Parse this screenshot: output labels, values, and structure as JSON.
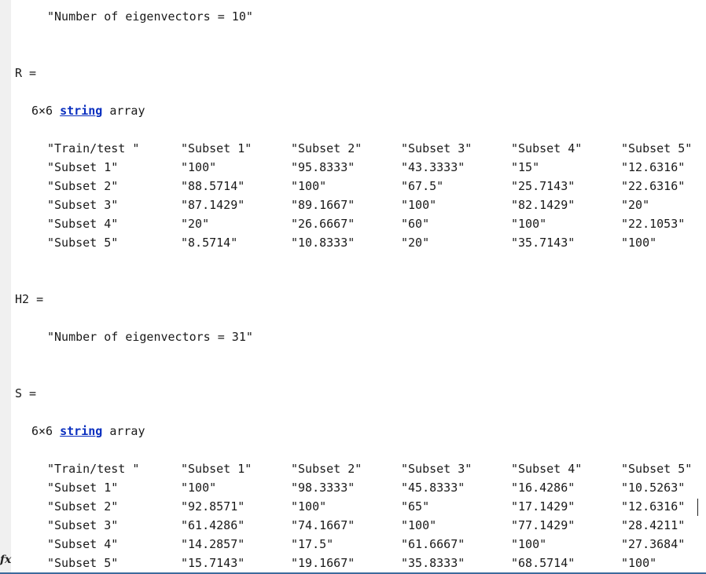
{
  "h1_value": "\"Number of eigenvectors = 10\"",
  "r_block": {
    "label": "R =",
    "size_text": "6×6",
    "class_link": "string",
    "class_suffix": "array",
    "rows": [
      [
        "\"Train/test \"",
        "\"Subset 1\"",
        "\"Subset 2\"",
        "\"Subset 3\"",
        "\"Subset 4\"",
        "\"Subset 5\""
      ],
      [
        "\"Subset 1\"",
        "\"100\"",
        "\"95.8333\"",
        "\"43.3333\"",
        "\"15\"",
        "\"12.6316\""
      ],
      [
        "\"Subset 2\"",
        "\"88.5714\"",
        "\"100\"",
        "\"67.5\"",
        "\"25.7143\"",
        "\"22.6316\""
      ],
      [
        "\"Subset 3\"",
        "\"87.1429\"",
        "\"89.1667\"",
        "\"100\"",
        "\"82.1429\"",
        "\"20\""
      ],
      [
        "\"Subset 4\"",
        "\"20\"",
        "\"26.6667\"",
        "\"60\"",
        "\"100\"",
        "\"22.1053\""
      ],
      [
        "\"Subset 5\"",
        "\"8.5714\"",
        "\"10.8333\"",
        "\"20\"",
        "\"35.7143\"",
        "\"100\""
      ]
    ]
  },
  "h2_block": {
    "label": "H2 =",
    "value": "\"Number of eigenvectors = 31\""
  },
  "s_block": {
    "label": "S =",
    "size_text": "6×6",
    "class_link": "string",
    "class_suffix": "array",
    "rows": [
      [
        "\"Train/test \"",
        "\"Subset 1\"",
        "\"Subset 2\"",
        "\"Subset 3\"",
        "\"Subset 4\"",
        "\"Subset 5\""
      ],
      [
        "\"Subset 1\"",
        "\"100\"",
        "\"98.3333\"",
        "\"45.8333\"",
        "\"16.4286\"",
        "\"10.5263\""
      ],
      [
        "\"Subset 2\"",
        "\"92.8571\"",
        "\"100\"",
        "\"65\"",
        "\"17.1429\"",
        "\"12.6316\""
      ],
      [
        "\"Subset 3\"",
        "\"61.4286\"",
        "\"74.1667\"",
        "\"100\"",
        "\"77.1429\"",
        "\"28.4211\""
      ],
      [
        "\"Subset 4\"",
        "\"14.2857\"",
        "\"17.5\"",
        "\"61.6667\"",
        "\"100\"",
        "\"27.3684\""
      ],
      [
        "\"Subset 5\"",
        "\"15.7143\"",
        "\"19.1667\"",
        "\"35.8333\"",
        "\"68.5714\"",
        "\"100\""
      ]
    ]
  },
  "prompt_icon": "fx",
  "colors": {
    "link": "#0a2fbf",
    "text": "#1a1a1a",
    "gutter": "#f0f0f0",
    "bottom_rule": "#3d6a9c"
  }
}
